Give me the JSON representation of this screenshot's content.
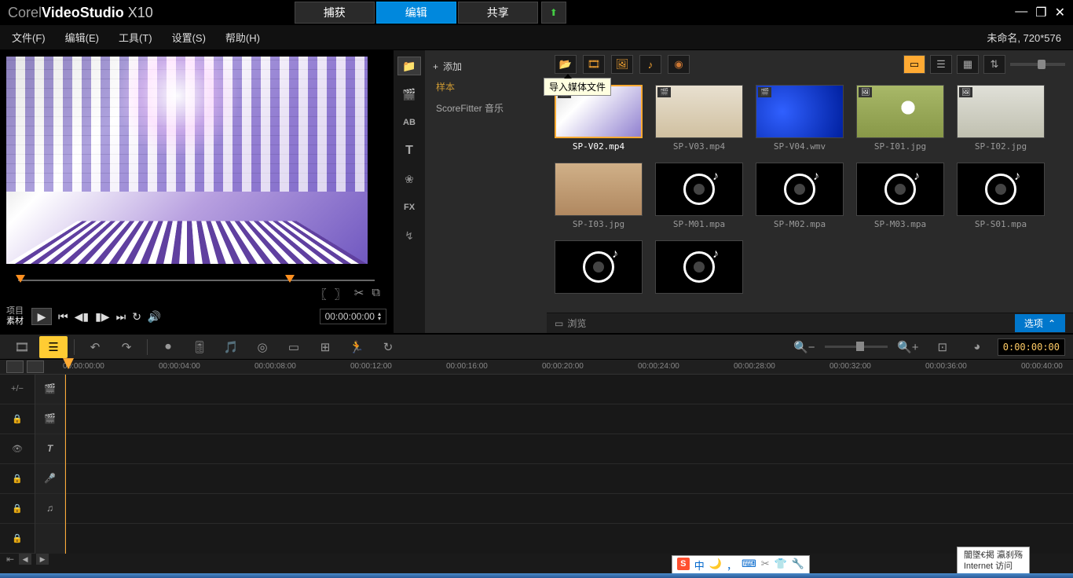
{
  "app": {
    "brand_corel": "Corel",
    "brand_vs": "VideoStudio",
    "brand_ver": " X10"
  },
  "top_tabs": {
    "capture": "捕获",
    "edit": "编辑",
    "share": "共享"
  },
  "menu": {
    "file": "文件(F)",
    "edit": "编辑(E)",
    "tools": "工具(T)",
    "settings": "设置(S)",
    "help": "帮助(H)"
  },
  "project_info": "未命名, 720*576",
  "playback": {
    "mode1": "项目",
    "mode2": "素材",
    "timecode": "00:00:00:00"
  },
  "library": {
    "add": "添加",
    "cat_sample": "样本",
    "cat_scorefitter": "ScoreFitter 音乐",
    "tooltip_import": "导入媒体文件",
    "browse": "浏览",
    "options": "选项",
    "items": [
      {
        "name": "SP-V02.mp4",
        "type": "v02",
        "selected": true,
        "badge": "🎬"
      },
      {
        "name": "SP-V03.mp4",
        "type": "v03",
        "badge": "🎬"
      },
      {
        "name": "SP-V04.wmv",
        "type": "v04",
        "badge": "🎬"
      },
      {
        "name": "SP-I01.jpg",
        "type": "i01",
        "badge": "🖼"
      },
      {
        "name": "SP-I02.jpg",
        "type": "i02",
        "badge": "🖼"
      },
      {
        "name": "SP-I03.jpg",
        "type": "i03"
      },
      {
        "name": "SP-M01.mpa",
        "type": "audio"
      },
      {
        "name": "SP-M02.mpa",
        "type": "audio"
      },
      {
        "name": "SP-M03.mpa",
        "type": "audio"
      },
      {
        "name": "SP-S01.mpa",
        "type": "audio"
      },
      {
        "name": "",
        "type": "audio"
      },
      {
        "name": "",
        "type": "audio"
      }
    ]
  },
  "timeline": {
    "timecode": "0:00:00:00",
    "ruler": [
      "00:00:00:00",
      "00:00:04:00",
      "00:00:08:00",
      "00:00:12:00",
      "00:00:16:00",
      "00:00:20:00",
      "00:00:24:00",
      "00:00:28:00",
      "00:00:32:00",
      "00:00:36:00",
      "00:00:40:00"
    ]
  },
  "ime": {
    "zhong": "中",
    "items": [
      "🌙",
      "⚙",
      "⌨",
      "✂",
      "👕",
      "🔧"
    ]
  },
  "net_popup": {
    "line1": "闇墜€掲   瀛刹殇",
    "line2": "Internet 访问"
  }
}
